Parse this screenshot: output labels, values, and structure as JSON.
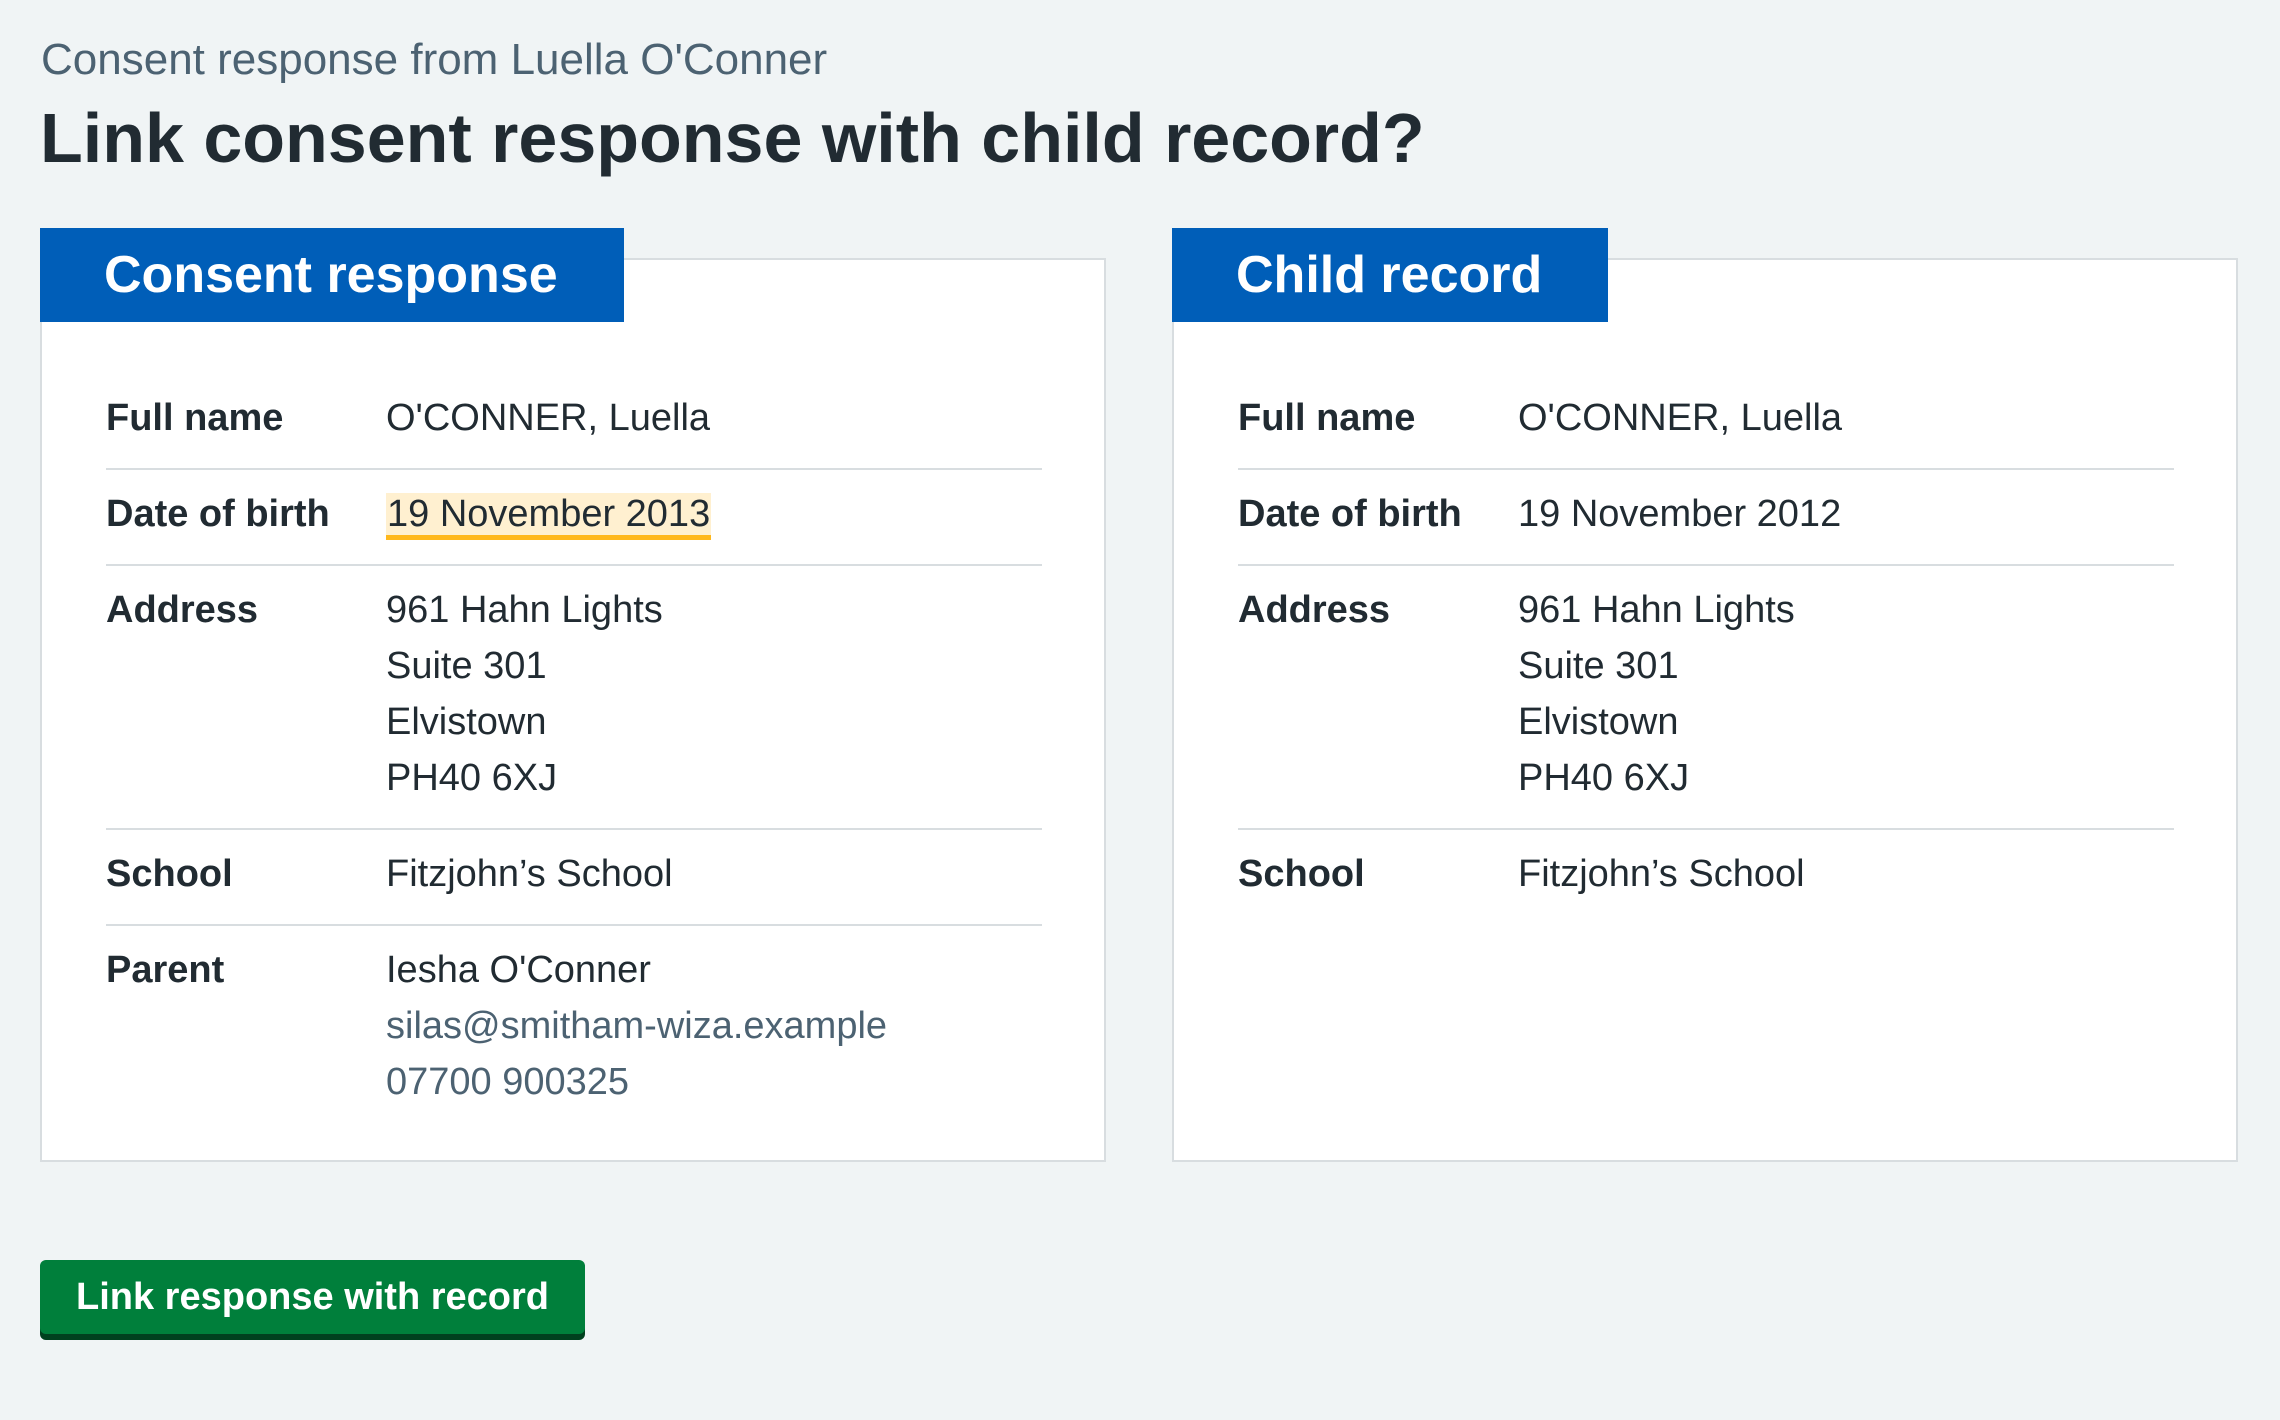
{
  "page": {
    "caption": "Consent response from Luella O'Conner",
    "title": "Link consent response with child record?"
  },
  "consent_response": {
    "heading": "Consent response",
    "full_name_label": "Full name",
    "full_name": "O'CONNER, Luella",
    "dob_label": "Date of birth",
    "dob": "19 November 2013",
    "dob_highlighted": true,
    "address_label": "Address",
    "address_lines": [
      "961 Hahn Lights",
      "Suite 301",
      "Elvistown",
      "PH40 6XJ"
    ],
    "school_label": "School",
    "school": "Fitzjohn’s School",
    "parent_label": "Parent",
    "parent_name": "Iesha O'Conner",
    "parent_email": "silas@smitham-wiza.example",
    "parent_phone": "07700 900325"
  },
  "child_record": {
    "heading": "Child record",
    "full_name_label": "Full name",
    "full_name": "O'CONNER, Luella",
    "dob_label": "Date of birth",
    "dob": "19 November 2012",
    "address_label": "Address",
    "address_lines": [
      "961 Hahn Lights",
      "Suite 301",
      "Elvistown",
      "PH40 6XJ"
    ],
    "school_label": "School",
    "school": "Fitzjohn’s School"
  },
  "actions": {
    "link_button_label": "Link response with record"
  },
  "colors": {
    "background": "#f0f4f5",
    "card_heading": "#005eb8",
    "button": "#007f3b",
    "highlight_bg": "#fff0d0",
    "highlight_border": "#ffb81c",
    "secondary_text": "#4c6272"
  }
}
